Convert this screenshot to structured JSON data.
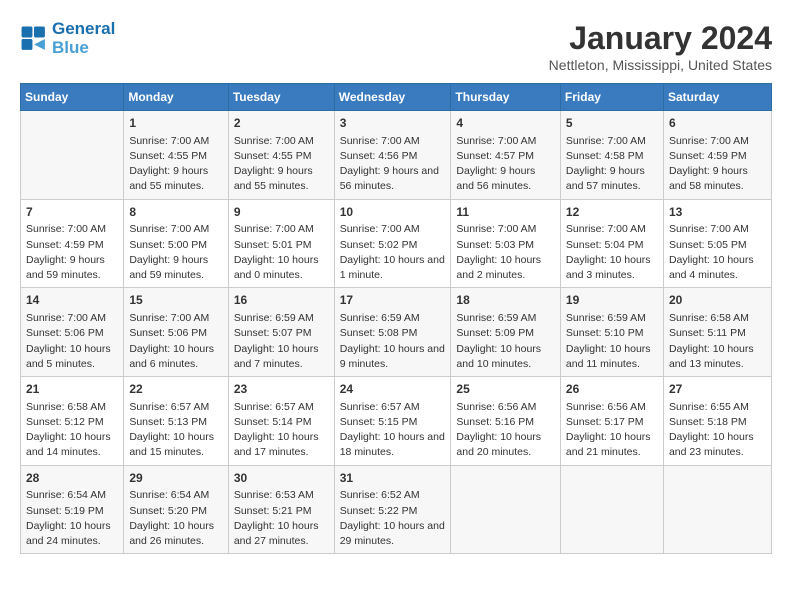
{
  "header": {
    "logo_line1": "General",
    "logo_line2": "Blue",
    "title": "January 2024",
    "subtitle": "Nettleton, Mississippi, United States"
  },
  "weekdays": [
    "Sunday",
    "Monday",
    "Tuesday",
    "Wednesday",
    "Thursday",
    "Friday",
    "Saturday"
  ],
  "weeks": [
    [
      {
        "day": "",
        "sunrise": "",
        "sunset": "",
        "daylight": ""
      },
      {
        "day": "1",
        "sunrise": "Sunrise: 7:00 AM",
        "sunset": "Sunset: 4:55 PM",
        "daylight": "Daylight: 9 hours and 55 minutes."
      },
      {
        "day": "2",
        "sunrise": "Sunrise: 7:00 AM",
        "sunset": "Sunset: 4:55 PM",
        "daylight": "Daylight: 9 hours and 55 minutes."
      },
      {
        "day": "3",
        "sunrise": "Sunrise: 7:00 AM",
        "sunset": "Sunset: 4:56 PM",
        "daylight": "Daylight: 9 hours and 56 minutes."
      },
      {
        "day": "4",
        "sunrise": "Sunrise: 7:00 AM",
        "sunset": "Sunset: 4:57 PM",
        "daylight": "Daylight: 9 hours and 56 minutes."
      },
      {
        "day": "5",
        "sunrise": "Sunrise: 7:00 AM",
        "sunset": "Sunset: 4:58 PM",
        "daylight": "Daylight: 9 hours and 57 minutes."
      },
      {
        "day": "6",
        "sunrise": "Sunrise: 7:00 AM",
        "sunset": "Sunset: 4:59 PM",
        "daylight": "Daylight: 9 hours and 58 minutes."
      }
    ],
    [
      {
        "day": "7",
        "sunrise": "Sunrise: 7:00 AM",
        "sunset": "Sunset: 4:59 PM",
        "daylight": "Daylight: 9 hours and 59 minutes."
      },
      {
        "day": "8",
        "sunrise": "Sunrise: 7:00 AM",
        "sunset": "Sunset: 5:00 PM",
        "daylight": "Daylight: 9 hours and 59 minutes."
      },
      {
        "day": "9",
        "sunrise": "Sunrise: 7:00 AM",
        "sunset": "Sunset: 5:01 PM",
        "daylight": "Daylight: 10 hours and 0 minutes."
      },
      {
        "day": "10",
        "sunrise": "Sunrise: 7:00 AM",
        "sunset": "Sunset: 5:02 PM",
        "daylight": "Daylight: 10 hours and 1 minute."
      },
      {
        "day": "11",
        "sunrise": "Sunrise: 7:00 AM",
        "sunset": "Sunset: 5:03 PM",
        "daylight": "Daylight: 10 hours and 2 minutes."
      },
      {
        "day": "12",
        "sunrise": "Sunrise: 7:00 AM",
        "sunset": "Sunset: 5:04 PM",
        "daylight": "Daylight: 10 hours and 3 minutes."
      },
      {
        "day": "13",
        "sunrise": "Sunrise: 7:00 AM",
        "sunset": "Sunset: 5:05 PM",
        "daylight": "Daylight: 10 hours and 4 minutes."
      }
    ],
    [
      {
        "day": "14",
        "sunrise": "Sunrise: 7:00 AM",
        "sunset": "Sunset: 5:06 PM",
        "daylight": "Daylight: 10 hours and 5 minutes."
      },
      {
        "day": "15",
        "sunrise": "Sunrise: 7:00 AM",
        "sunset": "Sunset: 5:06 PM",
        "daylight": "Daylight: 10 hours and 6 minutes."
      },
      {
        "day": "16",
        "sunrise": "Sunrise: 6:59 AM",
        "sunset": "Sunset: 5:07 PM",
        "daylight": "Daylight: 10 hours and 7 minutes."
      },
      {
        "day": "17",
        "sunrise": "Sunrise: 6:59 AM",
        "sunset": "Sunset: 5:08 PM",
        "daylight": "Daylight: 10 hours and 9 minutes."
      },
      {
        "day": "18",
        "sunrise": "Sunrise: 6:59 AM",
        "sunset": "Sunset: 5:09 PM",
        "daylight": "Daylight: 10 hours and 10 minutes."
      },
      {
        "day": "19",
        "sunrise": "Sunrise: 6:59 AM",
        "sunset": "Sunset: 5:10 PM",
        "daylight": "Daylight: 10 hours and 11 minutes."
      },
      {
        "day": "20",
        "sunrise": "Sunrise: 6:58 AM",
        "sunset": "Sunset: 5:11 PM",
        "daylight": "Daylight: 10 hours and 13 minutes."
      }
    ],
    [
      {
        "day": "21",
        "sunrise": "Sunrise: 6:58 AM",
        "sunset": "Sunset: 5:12 PM",
        "daylight": "Daylight: 10 hours and 14 minutes."
      },
      {
        "day": "22",
        "sunrise": "Sunrise: 6:57 AM",
        "sunset": "Sunset: 5:13 PM",
        "daylight": "Daylight: 10 hours and 15 minutes."
      },
      {
        "day": "23",
        "sunrise": "Sunrise: 6:57 AM",
        "sunset": "Sunset: 5:14 PM",
        "daylight": "Daylight: 10 hours and 17 minutes."
      },
      {
        "day": "24",
        "sunrise": "Sunrise: 6:57 AM",
        "sunset": "Sunset: 5:15 PM",
        "daylight": "Daylight: 10 hours and 18 minutes."
      },
      {
        "day": "25",
        "sunrise": "Sunrise: 6:56 AM",
        "sunset": "Sunset: 5:16 PM",
        "daylight": "Daylight: 10 hours and 20 minutes."
      },
      {
        "day": "26",
        "sunrise": "Sunrise: 6:56 AM",
        "sunset": "Sunset: 5:17 PM",
        "daylight": "Daylight: 10 hours and 21 minutes."
      },
      {
        "day": "27",
        "sunrise": "Sunrise: 6:55 AM",
        "sunset": "Sunset: 5:18 PM",
        "daylight": "Daylight: 10 hours and 23 minutes."
      }
    ],
    [
      {
        "day": "28",
        "sunrise": "Sunrise: 6:54 AM",
        "sunset": "Sunset: 5:19 PM",
        "daylight": "Daylight: 10 hours and 24 minutes."
      },
      {
        "day": "29",
        "sunrise": "Sunrise: 6:54 AM",
        "sunset": "Sunset: 5:20 PM",
        "daylight": "Daylight: 10 hours and 26 minutes."
      },
      {
        "day": "30",
        "sunrise": "Sunrise: 6:53 AM",
        "sunset": "Sunset: 5:21 PM",
        "daylight": "Daylight: 10 hours and 27 minutes."
      },
      {
        "day": "31",
        "sunrise": "Sunrise: 6:52 AM",
        "sunset": "Sunset: 5:22 PM",
        "daylight": "Daylight: 10 hours and 29 minutes."
      },
      {
        "day": "",
        "sunrise": "",
        "sunset": "",
        "daylight": ""
      },
      {
        "day": "",
        "sunrise": "",
        "sunset": "",
        "daylight": ""
      },
      {
        "day": "",
        "sunrise": "",
        "sunset": "",
        "daylight": ""
      }
    ]
  ]
}
